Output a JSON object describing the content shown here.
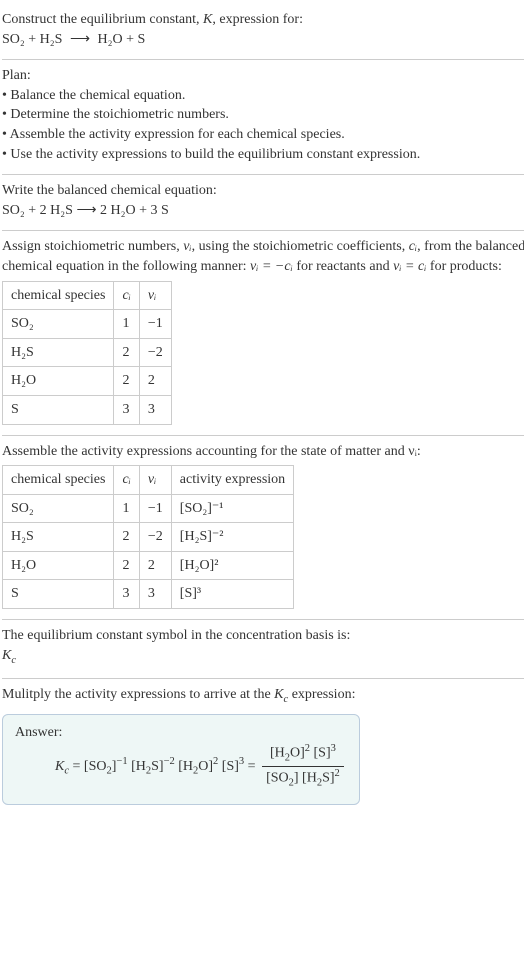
{
  "intro": {
    "line1": "Construct the equilibrium constant, ",
    "K": "K",
    "line1b": ", expression for:",
    "eq_reactants": "SO₂ + H₂S",
    "eq_arrow": "⟶",
    "eq_products": "H₂O + S"
  },
  "plan": {
    "heading": "Plan:",
    "bullet1": "• Balance the chemical equation.",
    "bullet2": "• Determine the stoichiometric numbers.",
    "bullet3": "• Assemble the activity expression for each chemical species.",
    "bullet4": "• Use the activity expressions to build the equilibrium constant expression."
  },
  "balanced": {
    "heading": "Write the balanced chemical equation:",
    "eq": "SO₂ + 2 H₂S ⟶ 2 H₂O + 3 S"
  },
  "stoich": {
    "text1": "Assign stoichiometric numbers, ",
    "nu": "νᵢ",
    "text2": ", using the stoichiometric coefficients, ",
    "ci": "cᵢ",
    "text3": ", from the balanced chemical equation in the following manner: ",
    "rule1": "νᵢ = −cᵢ",
    "text4": " for reactants and ",
    "rule2": "νᵢ = cᵢ",
    "text5": " for products:",
    "header": {
      "col1": "chemical species",
      "col2": "cᵢ",
      "col3": "νᵢ"
    },
    "rows": [
      {
        "species": "SO₂",
        "c": "1",
        "nu": "−1"
      },
      {
        "species": "H₂S",
        "c": "2",
        "nu": "−2"
      },
      {
        "species": "H₂O",
        "c": "2",
        "nu": "2"
      },
      {
        "species": "S",
        "c": "3",
        "nu": "3"
      }
    ]
  },
  "activity": {
    "heading": "Assemble the activity expressions accounting for the state of matter and νᵢ:",
    "header": {
      "col1": "chemical species",
      "col2": "cᵢ",
      "col3": "νᵢ",
      "col4": "activity expression"
    },
    "rows": [
      {
        "species": "SO₂",
        "c": "1",
        "nu": "−1",
        "expr": "[SO₂]⁻¹"
      },
      {
        "species": "H₂S",
        "c": "2",
        "nu": "−2",
        "expr": "[H₂S]⁻²"
      },
      {
        "species": "H₂O",
        "c": "2",
        "nu": "2",
        "expr": "[H₂O]²"
      },
      {
        "species": "S",
        "c": "3",
        "nu": "3",
        "expr": "[S]³"
      }
    ]
  },
  "basis": {
    "line1": "The equilibrium constant symbol in the concentration basis is:",
    "symbol": "K_c"
  },
  "final": {
    "heading": "Mulitply the activity expressions to arrive at the K_c expression:",
    "answer_label": "Answer:",
    "lhs": "K_c = [SO₂]⁻¹ [H₂S]⁻² [H₂O]² [S]³ =",
    "frac_num": "[H₂O]² [S]³",
    "frac_den": "[SO₂] [H₂S]²"
  },
  "chart_data": {
    "type": "table",
    "tables": [
      {
        "title": "Stoichiometric numbers",
        "columns": [
          "chemical species",
          "c_i",
          "nu_i"
        ],
        "rows": [
          [
            "SO2",
            1,
            -1
          ],
          [
            "H2S",
            2,
            -2
          ],
          [
            "H2O",
            2,
            2
          ],
          [
            "S",
            3,
            3
          ]
        ]
      },
      {
        "title": "Activity expressions",
        "columns": [
          "chemical species",
          "c_i",
          "nu_i",
          "activity expression"
        ],
        "rows": [
          [
            "SO2",
            1,
            -1,
            "[SO2]^-1"
          ],
          [
            "H2S",
            2,
            -2,
            "[H2S]^-2"
          ],
          [
            "H2O",
            2,
            2,
            "[H2O]^2"
          ],
          [
            "S",
            3,
            3,
            "[S]^3"
          ]
        ]
      }
    ]
  }
}
